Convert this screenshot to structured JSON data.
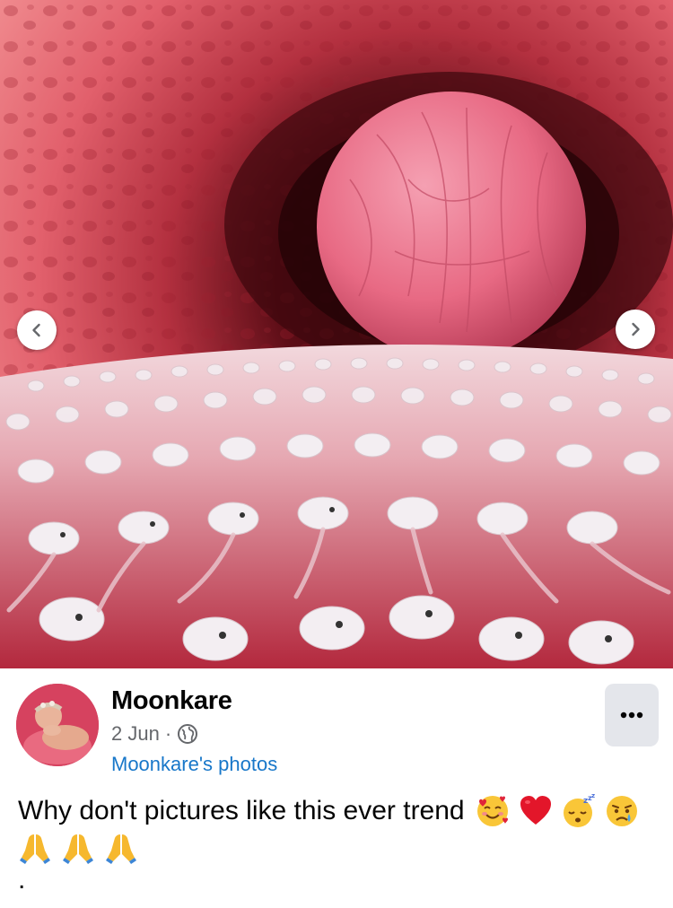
{
  "post": {
    "author": "Moonkare",
    "date": "2 Jun",
    "separator": "·",
    "privacy_icon": "globe-icon",
    "album_link": "Moonkare's photos",
    "more_icon": "more-dots-icon",
    "caption_text": "Why don't pictures like this ever trend",
    "caption_emojis_line1": [
      "smiling-face-with-hearts",
      "red-heart",
      "sleeping-face",
      "crying-face"
    ],
    "caption_emojis_line2": [
      "folded-hands",
      "folded-hands",
      "folded-hands"
    ],
    "caption_trailing": "."
  },
  "photo": {
    "prev_icon": "chevron-left-icon",
    "next_icon": "chevron-right-icon"
  },
  "colors": {
    "name_text": "#050505",
    "meta_text": "#65676b",
    "link": "#1877c9",
    "more_button_bg": "#e4e6eb"
  }
}
